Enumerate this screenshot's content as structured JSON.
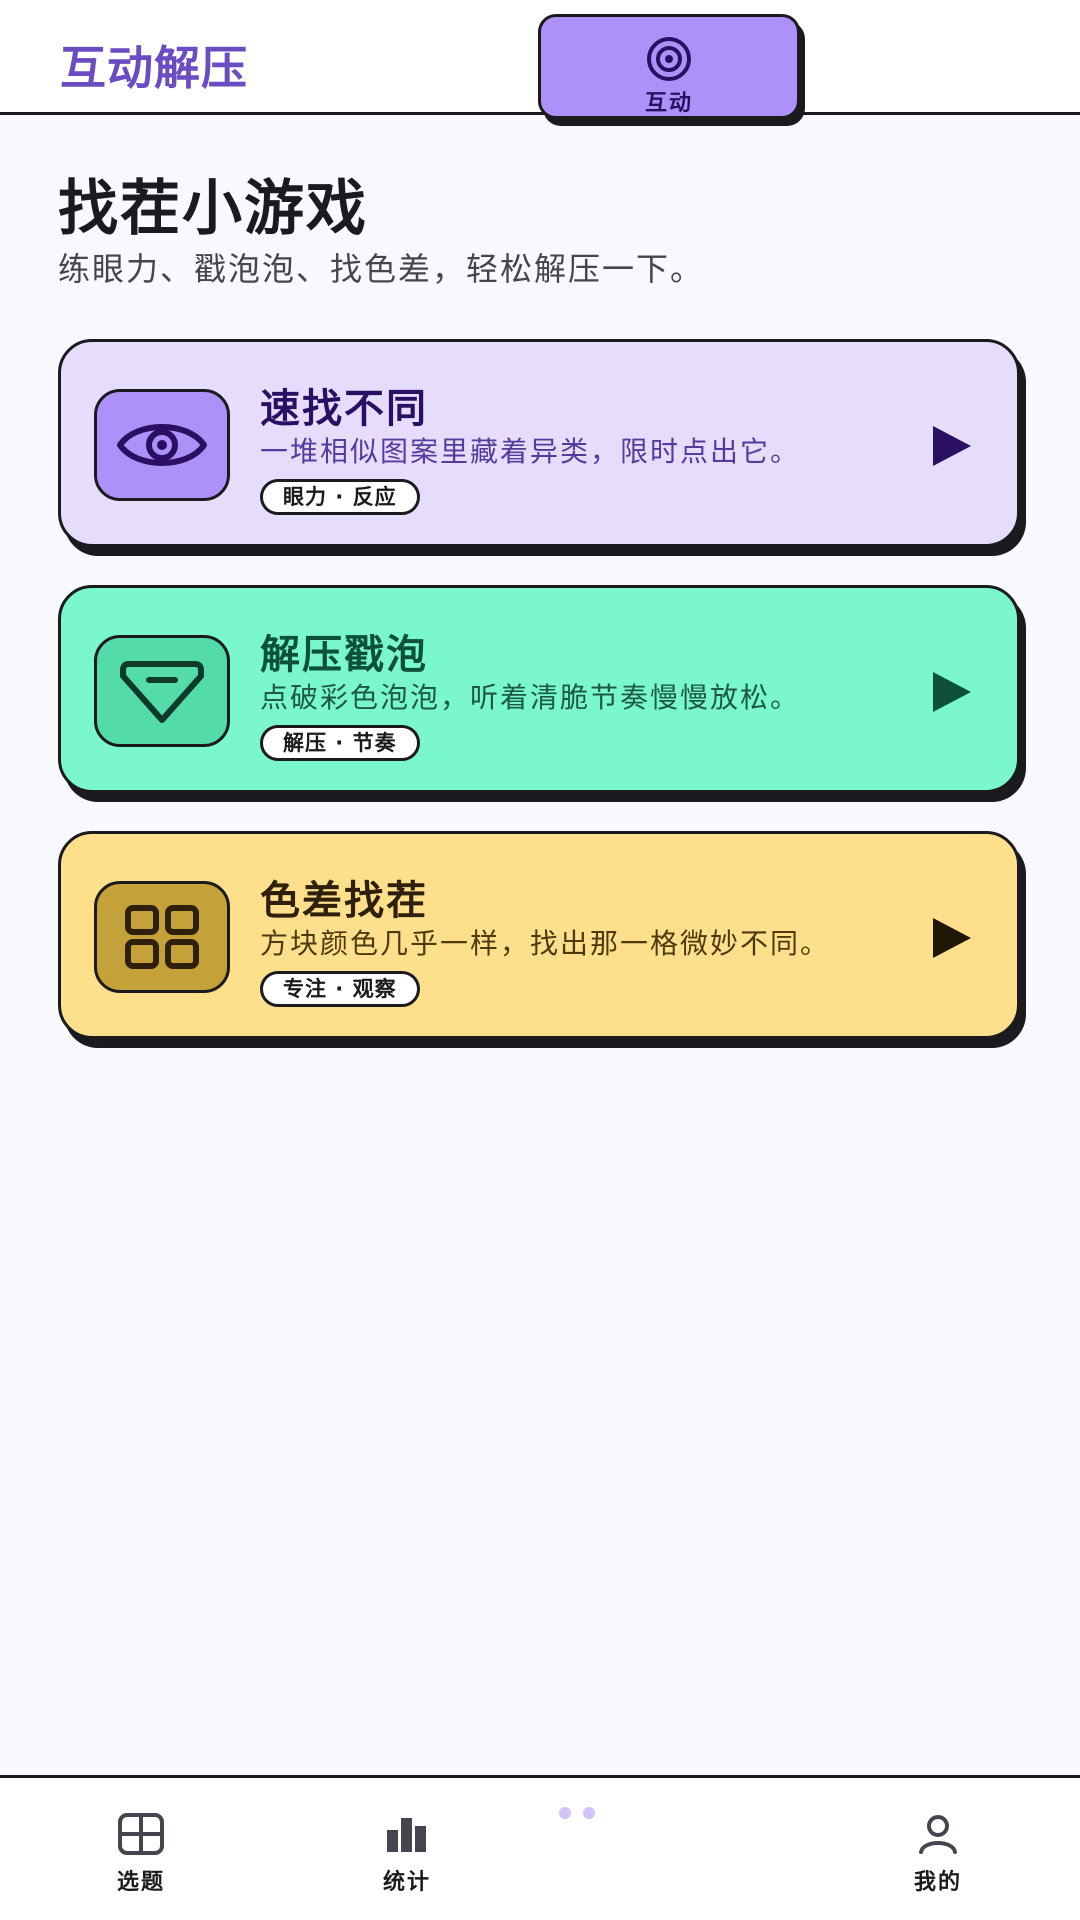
{
  "app_bar": {
    "title": "互动解压"
  },
  "header": {
    "title": "找茬小游戏",
    "subtitle": "练眼力、戳泡泡、找色差，轻松解压一下。"
  },
  "games": [
    {
      "title": "速找不同",
      "description": "一堆相似图案里藏着异类，限时点出它。",
      "tag": "眼力 · 反应",
      "icon": "eye-icon",
      "background": "#e6ddfd",
      "accent": "#2a0f63"
    },
    {
      "title": "解压戳泡",
      "description": "点破彩色泡泡，听着清脆节奏慢慢放松。",
      "tag": "解压 · 节奏",
      "icon": "gem-icon",
      "background": "#7af8cc",
      "accent": "#0d5238"
    },
    {
      "title": "色差找茬",
      "description": "方块颜色几乎一样，找出那一格微妙不同。",
      "tag": "专注 · 观察",
      "icon": "grid-icon",
      "background": "#fddf8c",
      "accent": "#2e200a"
    }
  ],
  "bottom_nav": {
    "items": [
      {
        "label": "选题",
        "icon": "grid-icon",
        "active": false
      },
      {
        "label": "统计",
        "icon": "bar-chart-icon",
        "active": false
      },
      {
        "label": "互动",
        "icon": "target-icon",
        "active": true
      },
      {
        "label": "我的",
        "icon": "user-icon",
        "active": false
      }
    ]
  },
  "colors": {
    "brand": "#6b4cc3",
    "active_tab": "#ad91f8",
    "page_background": "#f8f9fd"
  }
}
